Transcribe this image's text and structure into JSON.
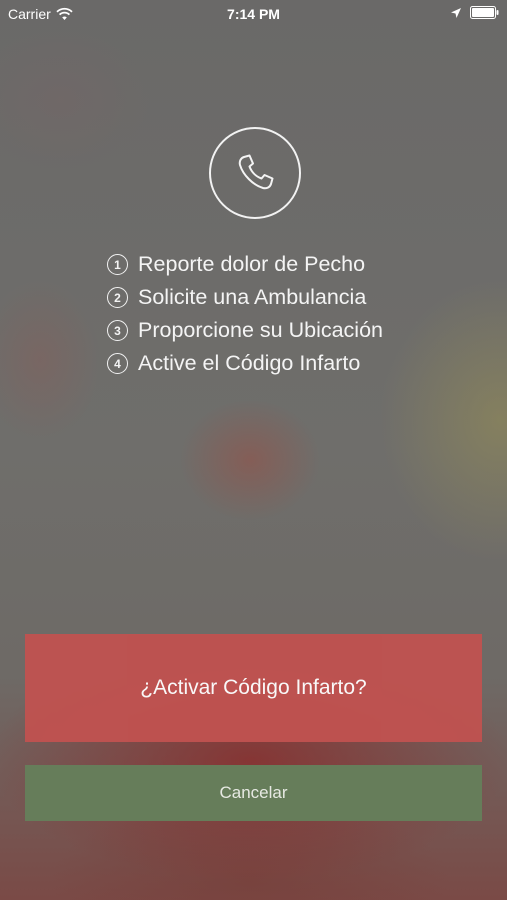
{
  "status_bar": {
    "carrier": "Carrier",
    "time": "7:14 PM",
    "icons": [
      "wifi-icon",
      "location-icon",
      "battery-icon"
    ]
  },
  "main": {
    "phone_icon": "phone-icon",
    "steps": [
      {
        "number": "1",
        "label": "Reporte dolor de Pecho"
      },
      {
        "number": "2",
        "label": "Solicite una Ambulancia"
      },
      {
        "number": "3",
        "label": "Proporcione su Ubicación"
      },
      {
        "number": "4",
        "label": "Active el Código Infarto"
      }
    ]
  },
  "actions": {
    "activate_label": "¿Activar Código Infarto?",
    "cancel_label": "Cancelar"
  },
  "colors": {
    "activate": "#c05250",
    "cancel": "#667d5a",
    "overlay": "#6e6e6c"
  }
}
